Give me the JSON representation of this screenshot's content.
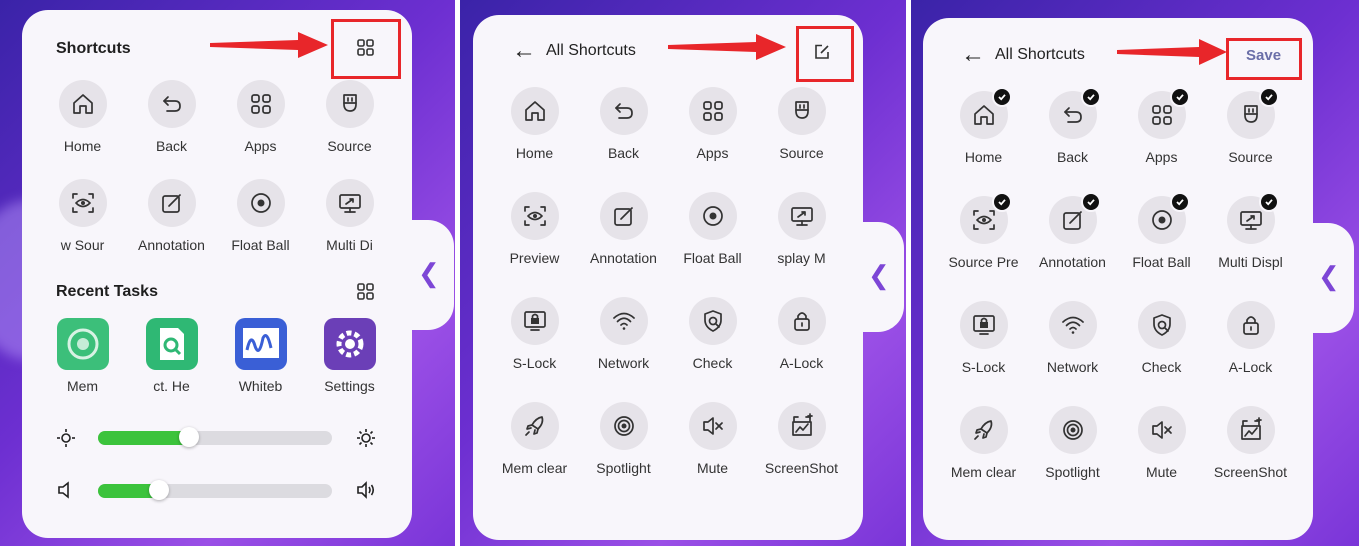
{
  "panel1": {
    "title": "Shortcuts",
    "shortcuts": [
      {
        "label": "Home",
        "icon": "home-icon"
      },
      {
        "label": "Back",
        "icon": "back-icon"
      },
      {
        "label": "Apps",
        "icon": "apps-icon"
      },
      {
        "label": "Source",
        "icon": "source-icon"
      },
      {
        "label": "w   Sour",
        "icon": "source-preview-icon"
      },
      {
        "label": "Annotation",
        "icon": "annotation-icon"
      },
      {
        "label": "Float Ball",
        "icon": "float-ball-icon"
      },
      {
        "label": "Multi Di",
        "icon": "multi-display-icon"
      }
    ],
    "recent_title": "Recent Tasks",
    "recent": [
      {
        "label": "Mem",
        "icon": "mem-clear-app-icon",
        "color": "#3cbf7a"
      },
      {
        "label": "ct. He",
        "icon": "help-app-icon",
        "color": "#2fb874"
      },
      {
        "label": "Whiteb",
        "icon": "whiteboard-app-icon",
        "color": "#3a5fd6"
      },
      {
        "label": "Settings",
        "icon": "settings-app-icon",
        "color": "#6b3fb7"
      }
    ],
    "brightness_level": 0.39,
    "volume_level": 0.26
  },
  "panel2": {
    "title": "All Shortcuts",
    "shortcuts": [
      {
        "label": "Home",
        "icon": "home-icon"
      },
      {
        "label": "Back",
        "icon": "back-icon"
      },
      {
        "label": "Apps",
        "icon": "apps-icon"
      },
      {
        "label": "Source",
        "icon": "source-icon"
      },
      {
        "label": "Preview",
        "icon": "source-preview-icon"
      },
      {
        "label": "Annotation",
        "icon": "annotation-icon"
      },
      {
        "label": "Float Ball",
        "icon": "float-ball-icon"
      },
      {
        "label": "splay    M",
        "icon": "multi-display-icon"
      },
      {
        "label": "S-Lock",
        "icon": "screen-lock-icon"
      },
      {
        "label": "Network",
        "icon": "network-icon"
      },
      {
        "label": "Check",
        "icon": "check-icon"
      },
      {
        "label": "A-Lock",
        "icon": "lock-icon"
      },
      {
        "label": "Mem clear",
        "icon": "mem-clear-icon"
      },
      {
        "label": "Spotlight",
        "icon": "spotlight-icon"
      },
      {
        "label": "Mute",
        "icon": "mute-icon"
      },
      {
        "label": "ScreenShot",
        "icon": "screenshot-icon"
      }
    ]
  },
  "panel3": {
    "title": "All Shortcuts",
    "save_label": "Save",
    "shortcuts": [
      {
        "label": "Home",
        "icon": "home-icon",
        "checked": true
      },
      {
        "label": "Back",
        "icon": "back-icon",
        "checked": true
      },
      {
        "label": "Apps",
        "icon": "apps-icon",
        "checked": true
      },
      {
        "label": "Source",
        "icon": "source-icon",
        "checked": true
      },
      {
        "label": "Source Pre",
        "icon": "source-preview-icon",
        "checked": true
      },
      {
        "label": "Annotation",
        "icon": "annotation-icon",
        "checked": true
      },
      {
        "label": "Float Ball",
        "icon": "float-ball-icon",
        "checked": true
      },
      {
        "label": "Multi Displ",
        "icon": "multi-display-icon",
        "checked": true
      },
      {
        "label": "S-Lock",
        "icon": "screen-lock-icon",
        "checked": false
      },
      {
        "label": "Network",
        "icon": "network-icon",
        "checked": false
      },
      {
        "label": "Check",
        "icon": "check-icon",
        "checked": false
      },
      {
        "label": "A-Lock",
        "icon": "lock-icon",
        "checked": false
      },
      {
        "label": "Mem clear",
        "icon": "mem-clear-icon",
        "checked": false
      },
      {
        "label": "Spotlight",
        "icon": "spotlight-icon",
        "checked": false
      },
      {
        "label": "Mute",
        "icon": "mute-icon",
        "checked": false
      },
      {
        "label": "ScreenShot",
        "icon": "screenshot-icon",
        "checked": false
      }
    ]
  },
  "colors": {
    "accent": "#e8262a",
    "slider_fill": "#3cc33c",
    "chevron": "#7d46d6",
    "panel": "#f8f6fb"
  }
}
